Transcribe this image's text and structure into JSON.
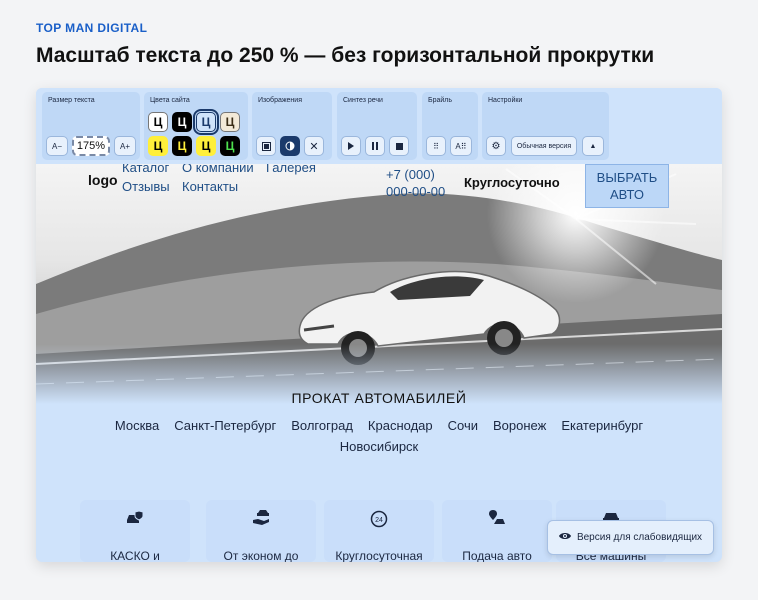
{
  "brand": "TOP MAN DIGITAL",
  "headline": "Масштаб текста до 250 % — без горизонтальной прокрутки",
  "toolbar": {
    "font_size": {
      "label": "Размер текста",
      "decrease": "A−",
      "value": "175%",
      "increase": "A+"
    },
    "colors": {
      "label": "Цвета сайта",
      "swatch_letter": "Ц"
    },
    "images": {
      "label": "Изображения",
      "icons": [
        "image-icon",
        "contrast-icon",
        "close-icon"
      ]
    },
    "speech": {
      "label": "Синтез речи",
      "icons": [
        "play-icon",
        "pause-icon",
        "stop-icon"
      ]
    },
    "braille": {
      "label": "Брайль",
      "icon1": "⠿",
      "icon2": "A⠿"
    },
    "settings": {
      "label": "Настройки",
      "gear": "⚙",
      "regular_version": "Обычная версия",
      "collapse": "▲"
    }
  },
  "site": {
    "logo": "logo",
    "nav": {
      "catalog": "Каталог",
      "about": "О компании",
      "gallery": "Галерея",
      "reviews": "Отзывы",
      "contacts": "Контакты"
    },
    "phone_line1": "+7 (000)",
    "phone_line2": "000-00-00",
    "hours": "Круглосуточно",
    "cta_line1": "ВЫБРАТЬ",
    "cta_line2": "АВТО",
    "section_title": "ПРОКАТ АВТОМАБИЛЕЙ",
    "cities": [
      "Москва",
      "Санкт-Петербург",
      "Волгоград",
      "Краснодар",
      "Сочи",
      "Воронеж",
      "Екатеринбург",
      "Новосибирск"
    ],
    "features": [
      {
        "icon": "car-shield-icon",
        "label": "КАСКО и"
      },
      {
        "icon": "hand-car-icon",
        "label": "От эконом до"
      },
      {
        "icon": "24h-icon",
        "label": "Круглосуточная"
      },
      {
        "icon": "map-pin-icon",
        "label": "Подача авто"
      },
      {
        "icon": "car-icon",
        "label": "Все машины"
      }
    ],
    "low_vision_button": "Версия для слабовидящих"
  },
  "colors": {
    "accent": "#1a5fc8",
    "frame_bg": "#cfe3fb",
    "toolbar_group": "#bfd8f6"
  }
}
